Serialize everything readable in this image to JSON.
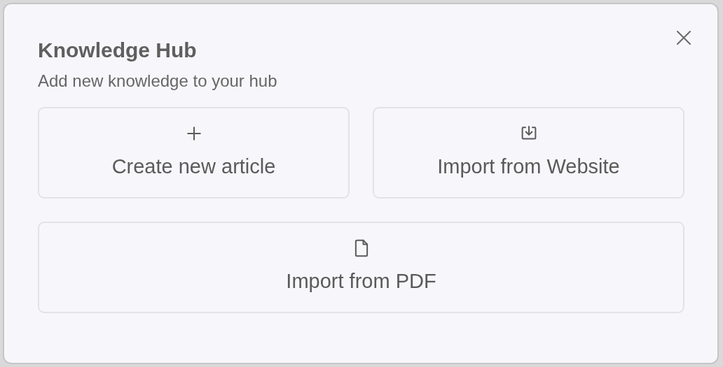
{
  "dialog": {
    "title": "Knowledge Hub",
    "subtitle": "Add new knowledge to your hub"
  },
  "options": [
    {
      "kind": "create",
      "label": "Create new article"
    },
    {
      "kind": "website",
      "label": "Import from Website"
    },
    {
      "kind": "pdf",
      "label": "Import from PDF"
    }
  ]
}
